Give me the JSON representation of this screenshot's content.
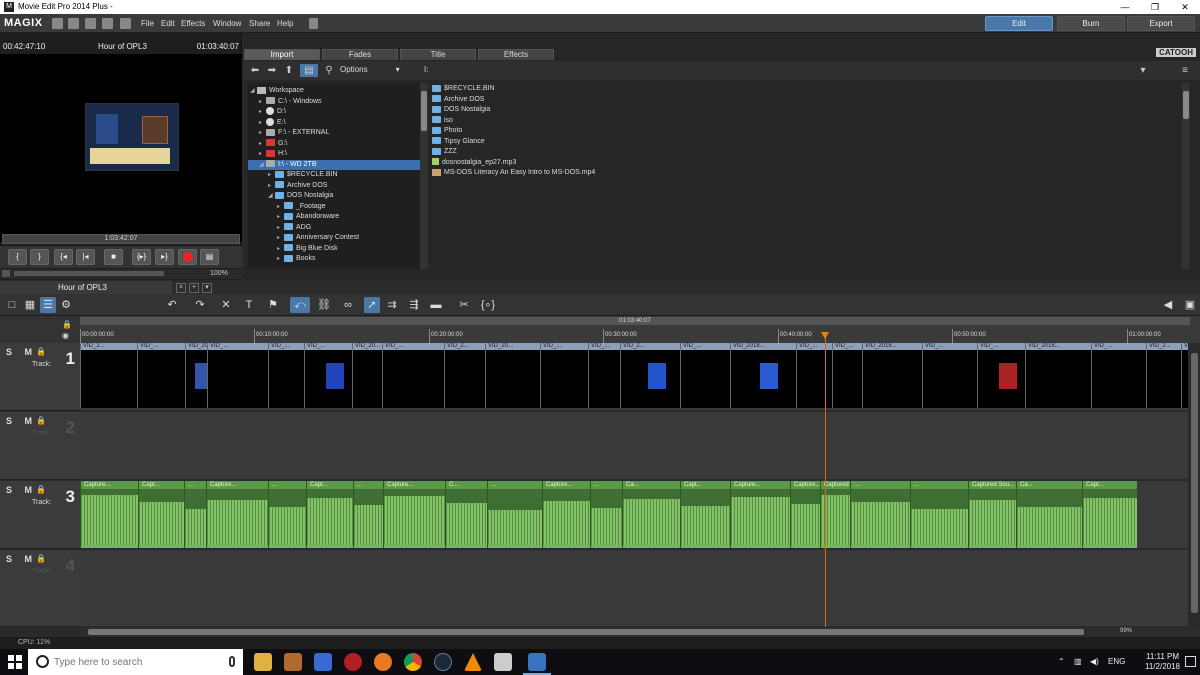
{
  "window": {
    "title": "Movie Edit Pro 2014 Plus -",
    "controls": {
      "minimize": "—",
      "maximize": "❐",
      "close": "✕"
    }
  },
  "menubar": {
    "logo": "MAGIX",
    "items": [
      "File",
      "Edit",
      "Effects",
      "Window",
      "Share",
      "Help"
    ],
    "modes": {
      "edit": "Edit",
      "burn": "Burn",
      "export": "Export"
    }
  },
  "monitor": {
    "position_tc": "00:42:47:10",
    "project_name": "Hour of OPL3",
    "duration_tc": "01:03:40:07",
    "scrub_tc": "1:03:42:07",
    "zoom": "100%",
    "transport": [
      "{",
      "}",
      "{◂",
      "|◂",
      "■",
      "{▸}",
      "▸}",
      "",
      "▤"
    ]
  },
  "pool": {
    "tabs": [
      "Import",
      "Fades",
      "Title",
      "Effects"
    ],
    "active_tab": "Import",
    "brand": "CATOOH",
    "options_label": "Options",
    "path": "I:",
    "tree": [
      {
        "label": "Workspace",
        "icon": "workspace-icon",
        "indent": 0,
        "arrow": "◢"
      },
      {
        "label": "C:\\ - Windows",
        "icon": "drive-icon",
        "indent": 1,
        "arrow": "▸"
      },
      {
        "label": "D:\\",
        "icon": "cd-icon",
        "indent": 1,
        "arrow": "▸"
      },
      {
        "label": "E:\\",
        "icon": "cd-icon",
        "indent": 1,
        "arrow": "▸"
      },
      {
        "label": "F:\\ - EXTERNAL",
        "icon": "drive-icon",
        "indent": 1,
        "arrow": "▸"
      },
      {
        "label": "G:\\",
        "icon": "usb-icon",
        "indent": 1,
        "arrow": "▸"
      },
      {
        "label": "H:\\",
        "icon": "usb-icon",
        "indent": 1,
        "arrow": "▸"
      },
      {
        "label": "I:\\ - WD 2TB",
        "icon": "drive-icon",
        "indent": 1,
        "arrow": "◢",
        "selected": true
      },
      {
        "label": "$RECYCLE.BIN",
        "icon": "folder-icon",
        "indent": 2,
        "arrow": "▸"
      },
      {
        "label": "Archive DOS",
        "icon": "folder-icon",
        "indent": 2,
        "arrow": "▸"
      },
      {
        "label": "DOS Nostalgia",
        "icon": "folder-icon",
        "indent": 2,
        "arrow": "◢"
      },
      {
        "label": "_Footage",
        "icon": "folder-icon",
        "indent": 3,
        "arrow": "▸"
      },
      {
        "label": "Abandonware",
        "icon": "folder-icon",
        "indent": 3,
        "arrow": "▸"
      },
      {
        "label": "ADG",
        "icon": "folder-icon",
        "indent": 3,
        "arrow": "▸"
      },
      {
        "label": "Anniversary Contest",
        "icon": "folder-icon",
        "indent": 3,
        "arrow": "▸"
      },
      {
        "label": "Big Blue Disk",
        "icon": "folder-icon",
        "indent": 3,
        "arrow": "▸"
      },
      {
        "label": "Books",
        "icon": "folder-icon",
        "indent": 3,
        "arrow": "▸"
      }
    ],
    "files": [
      {
        "name": "$RECYCLE.BIN",
        "icon": "folder-icon"
      },
      {
        "name": "Archive DOS",
        "icon": "folder-icon"
      },
      {
        "name": "DOS Nostalgia",
        "icon": "folder-icon"
      },
      {
        "name": "iso",
        "icon": "folder-icon"
      },
      {
        "name": "Photo",
        "icon": "folder-icon"
      },
      {
        "name": "Tipsy Glance",
        "icon": "folder-icon"
      },
      {
        "name": "ZZZ",
        "icon": "folder-icon"
      },
      {
        "name": "dosnostalgia_ep27.mp3",
        "icon": "audio-file-icon"
      },
      {
        "name": "MS-DOS Literacy An Easy Intro to MS-DOS.mp4",
        "icon": "video-file-icon"
      }
    ]
  },
  "timeline": {
    "tab": "Hour of OPL3",
    "marker_tc": "01:03:40:07",
    "ruler": [
      "00:00:00:00",
      "00:10:00:00",
      "00:20:00:00",
      "00:30:00:00",
      "00:40:00:00",
      "00:50:00:00",
      "01:00:00:00"
    ],
    "tracks": [
      {
        "number": "1",
        "label": "Track:",
        "sml": "S M",
        "dim": false
      },
      {
        "number": "2",
        "label": "Track:",
        "sml": "S M",
        "dim": true
      },
      {
        "number": "3",
        "label": "Track:",
        "sml": "S M",
        "dim": false
      },
      {
        "number": "4",
        "label": "Track:",
        "sml": "S M",
        "dim": true
      }
    ],
    "video_clips": [
      "VID_2...",
      "VID_...",
      "VID_20...",
      "VID_...",
      "VID_...",
      "VID_...",
      "VID_20...",
      "VID_...",
      "VID_2...",
      "VID_20...",
      "VID_...",
      "VID_...",
      "VID_2...",
      "VID_...",
      "VID_2018...",
      "VID_...",
      "VID_...",
      "VID_2018...",
      "VID_...",
      "VID_...",
      "VID_2018...",
      "VID_...",
      "VID_2...",
      "VID_..."
    ],
    "audio_clips": [
      "Capture...",
      "Capt...",
      "...",
      "Capture...",
      "...",
      "Capt...",
      "...",
      "Capture...",
      "C...",
      "...",
      "Capture...",
      "...",
      "Ca...",
      "Capt...",
      "Capture...",
      "Capture...",
      "Captured ...",
      "...",
      "...",
      "Captured Sou...",
      "Ca...",
      "Capt..."
    ],
    "zoom_pct": "99%",
    "cpu": "CPU: 11%"
  },
  "taskbar": {
    "search_placeholder": "Type here to search",
    "tray_lang": "ENG",
    "time": "11:11 PM",
    "date": "11/2/2018"
  }
}
